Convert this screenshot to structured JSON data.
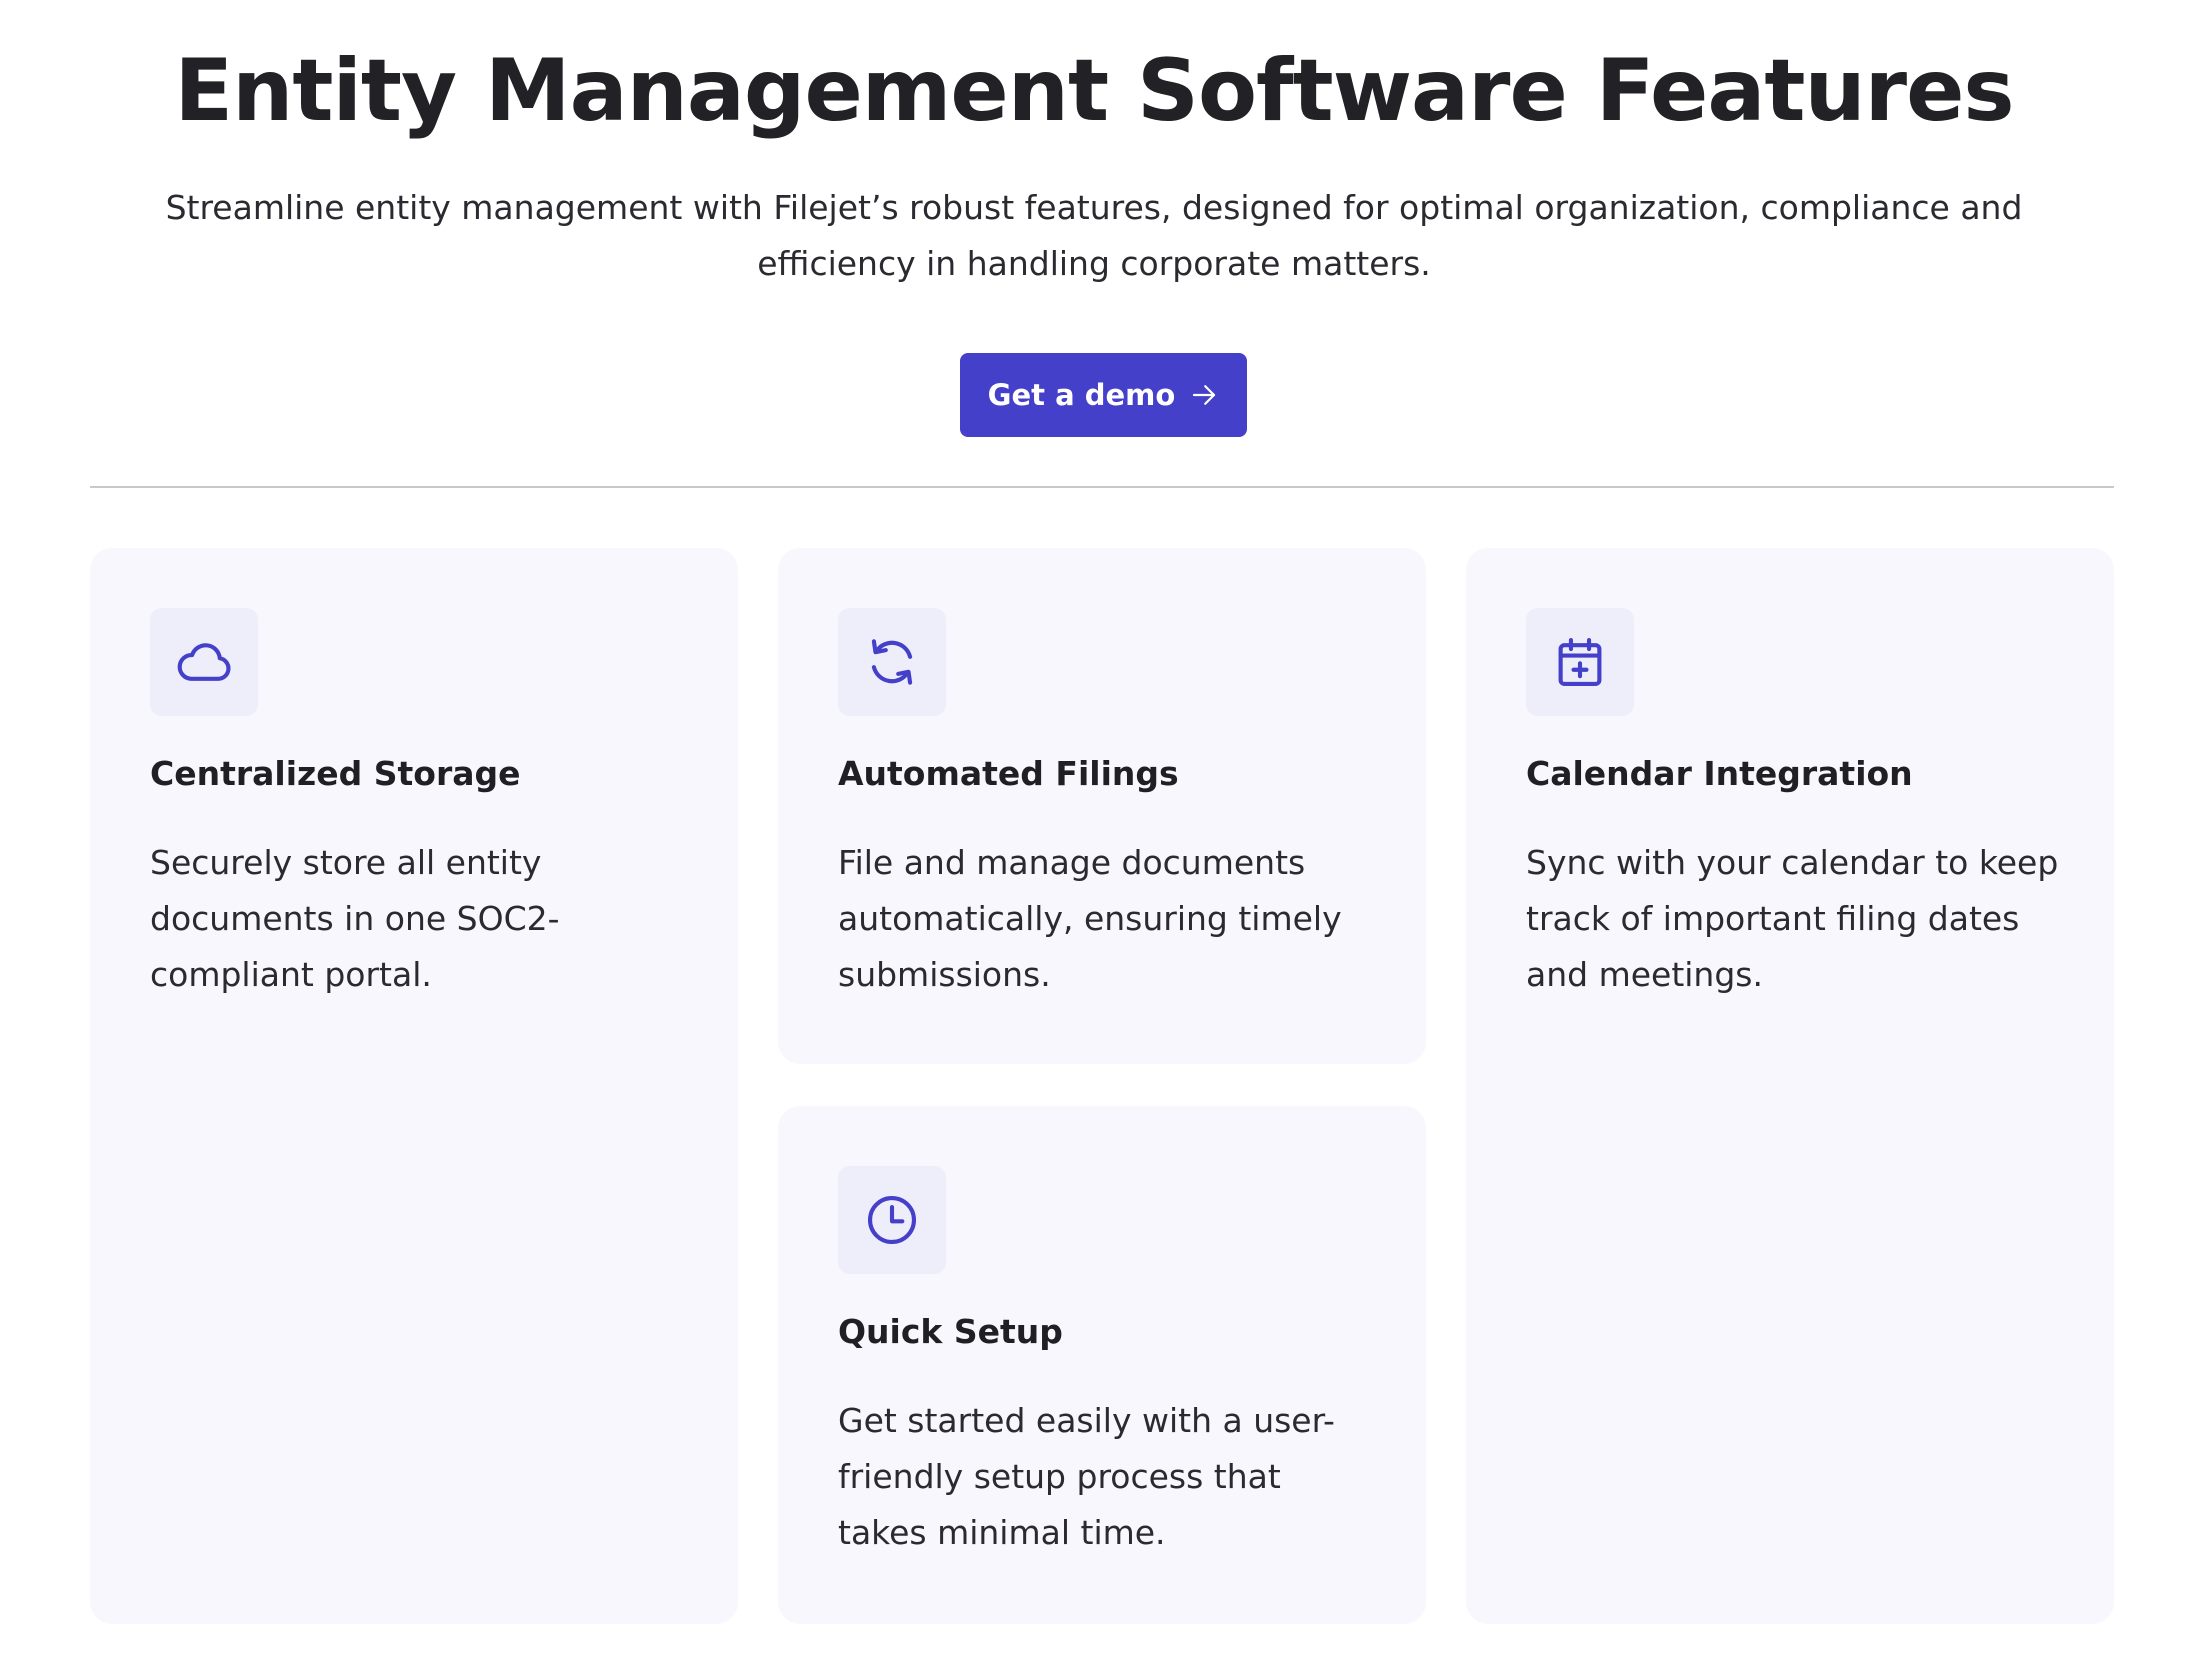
{
  "header": {
    "title": "Entity Management Software Features",
    "subtitle": "Streamline entity management with Filejet’s robust features, designed for optimal organization, compliance and efficiency in handling corporate matters."
  },
  "cta": {
    "label": "Get a demo",
    "icon": "arrow-right-icon"
  },
  "colors": {
    "accent": "#4440c9",
    "card_background": "#f7f7fd",
    "icon_background": "#eeeefb",
    "divider": "#c9c9cc"
  },
  "features": [
    {
      "icon": "cloud-icon",
      "title": "Centralized Storage",
      "description": "Securely store all entity documents in one SOC2-compliant portal."
    },
    {
      "icon": "refresh-icon",
      "title": "Automated Filings",
      "description": "File and manage documents automatically, ensuring timely submissions."
    },
    {
      "icon": "clock-icon",
      "title": "Quick Setup",
      "description": "Get started easily with a user-friendly setup process that takes minimal time."
    },
    {
      "icon": "calendar-plus-icon",
      "title": "Calendar Integration",
      "description": "Sync with your calendar to keep track of important filing dates and meetings."
    }
  ]
}
